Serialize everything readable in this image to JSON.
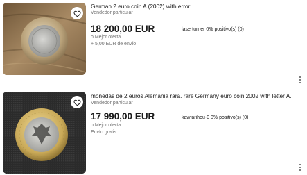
{
  "listings": [
    {
      "title": "German 2 euro coin A (2002) with error",
      "seller_type": "Vendedor particular",
      "price": "18 200,00 EUR",
      "seller": "laserturner 0% positivo(s) (0)",
      "offer": "o Mejor oferta",
      "shipping": "+ 5,00 EUR de envío",
      "favorite_icon": "heart-outline-icon",
      "more_icon": "vertical-ellipsis-icon"
    },
    {
      "title": "monedas de 2 euros Alemania rara. rare Germany euro coin 2002 with letter A.",
      "seller_type": "Vendedor particular",
      "price": "17 990,00 EUR",
      "seller": "kawfarihou-0 0% positivo(s) (0)",
      "offer": "o Mejor oferta",
      "shipping": "Envío gratis",
      "favorite_icon": "heart-outline-icon",
      "more_icon": "vertical-ellipsis-icon"
    }
  ],
  "colors": {
    "text": "#191919",
    "muted": "#707070",
    "divider": "#e5e5e5"
  }
}
